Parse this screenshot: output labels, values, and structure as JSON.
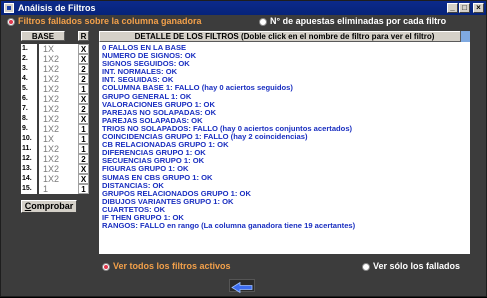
{
  "window": {
    "title": "Análisis de Filtros"
  },
  "titlebar_buttons": {
    "minimize": "_",
    "maximize": "□",
    "close": "×"
  },
  "options_top": {
    "filtered": "Filtros fallados sobre la columna ganadora",
    "eliminated": "N° de apuestas eliminadas por cada filtro"
  },
  "base_table": {
    "header_base": "BASE",
    "header_r": "R",
    "rows": [
      {
        "num": "1.",
        "base": "1X",
        "r": "X"
      },
      {
        "num": "2.",
        "base": "1X2",
        "r": "X"
      },
      {
        "num": "3.",
        "base": "1X2",
        "r": "2"
      },
      {
        "num": "4.",
        "base": "1X2",
        "r": "2"
      },
      {
        "num": "5.",
        "base": "1X2",
        "r": "1"
      },
      {
        "num": "6.",
        "base": "1X2",
        "r": "X"
      },
      {
        "num": "7.",
        "base": "1X2",
        "r": "2"
      },
      {
        "num": "8.",
        "base": "1X2",
        "r": "X"
      },
      {
        "num": "9.",
        "base": "1X2",
        "r": "1"
      },
      {
        "num": "10.",
        "base": "1X",
        "r": "1"
      },
      {
        "num": "11.",
        "base": "1X2",
        "r": "1"
      },
      {
        "num": "12.",
        "base": "1X2",
        "r": "2"
      },
      {
        "num": "13.",
        "base": "1X2",
        "r": "X"
      },
      {
        "num": "14.",
        "base": "1X2",
        "r": "X"
      },
      {
        "num": "15.",
        "base": "1",
        "r": "1"
      }
    ]
  },
  "buttons": {
    "comprobar_first": "C",
    "comprobar_rest": "omprobar"
  },
  "detail": {
    "header": "DETALLE DE LOS FILTROS (Doble click en el nombre de filtro para ver el filtro)",
    "lines": [
      "0 FALLOS EN LA BASE",
      "NUMERO DE SIGNOS: OK",
      "SIGNOS SEGUIDOS: OK",
      "INT. NORMALES: OK",
      "INT. SEGUIDAS: OK",
      "COLUMNA BASE 1: FALLO (hay 0 aciertos seguidos)",
      "GRUPO GENERAL 1: OK",
      "VALORACIONES GRUPO 1: OK",
      "PAREJAS NO SOLAPADAS: OK",
      "PAREJAS SOLAPADAS: OK",
      "TRIOS NO SOLAPADOS: FALLO (hay 0 aciertos conjuntos acertados)",
      "COINCIDENCIAS GRUPO 1: FALLO (hay 2 coincidencias)",
      "CB RELACIONADAS GRUPO 1: OK",
      "DIFERENCIAS GRUPO 1: OK",
      "SECUENCIAS GRUPO 1: OK",
      "FIGURAS GRUPO 1: OK",
      "SUMAS EN CBS GRUPO 1: OK",
      "DISTANCIAS: OK",
      "GRUPOS RELACIONADOS GRUPO 1: OK",
      "DIBUJOS VARIANTES GRUPO 1: OK",
      "CUARTETOS: OK",
      "IF THEN GRUPO 1: OK",
      "RANGOS: FALLO en rango (La columna ganadora tiene 19 acertantes)"
    ]
  },
  "options_bottom": {
    "all": "Ver todos los filtros activos",
    "failed": "Ver sólo los fallados"
  },
  "colors": {
    "accent_orange": "#f2a04a",
    "list_text": "#1a2fc0",
    "title_bar": "#0c2a8a"
  }
}
